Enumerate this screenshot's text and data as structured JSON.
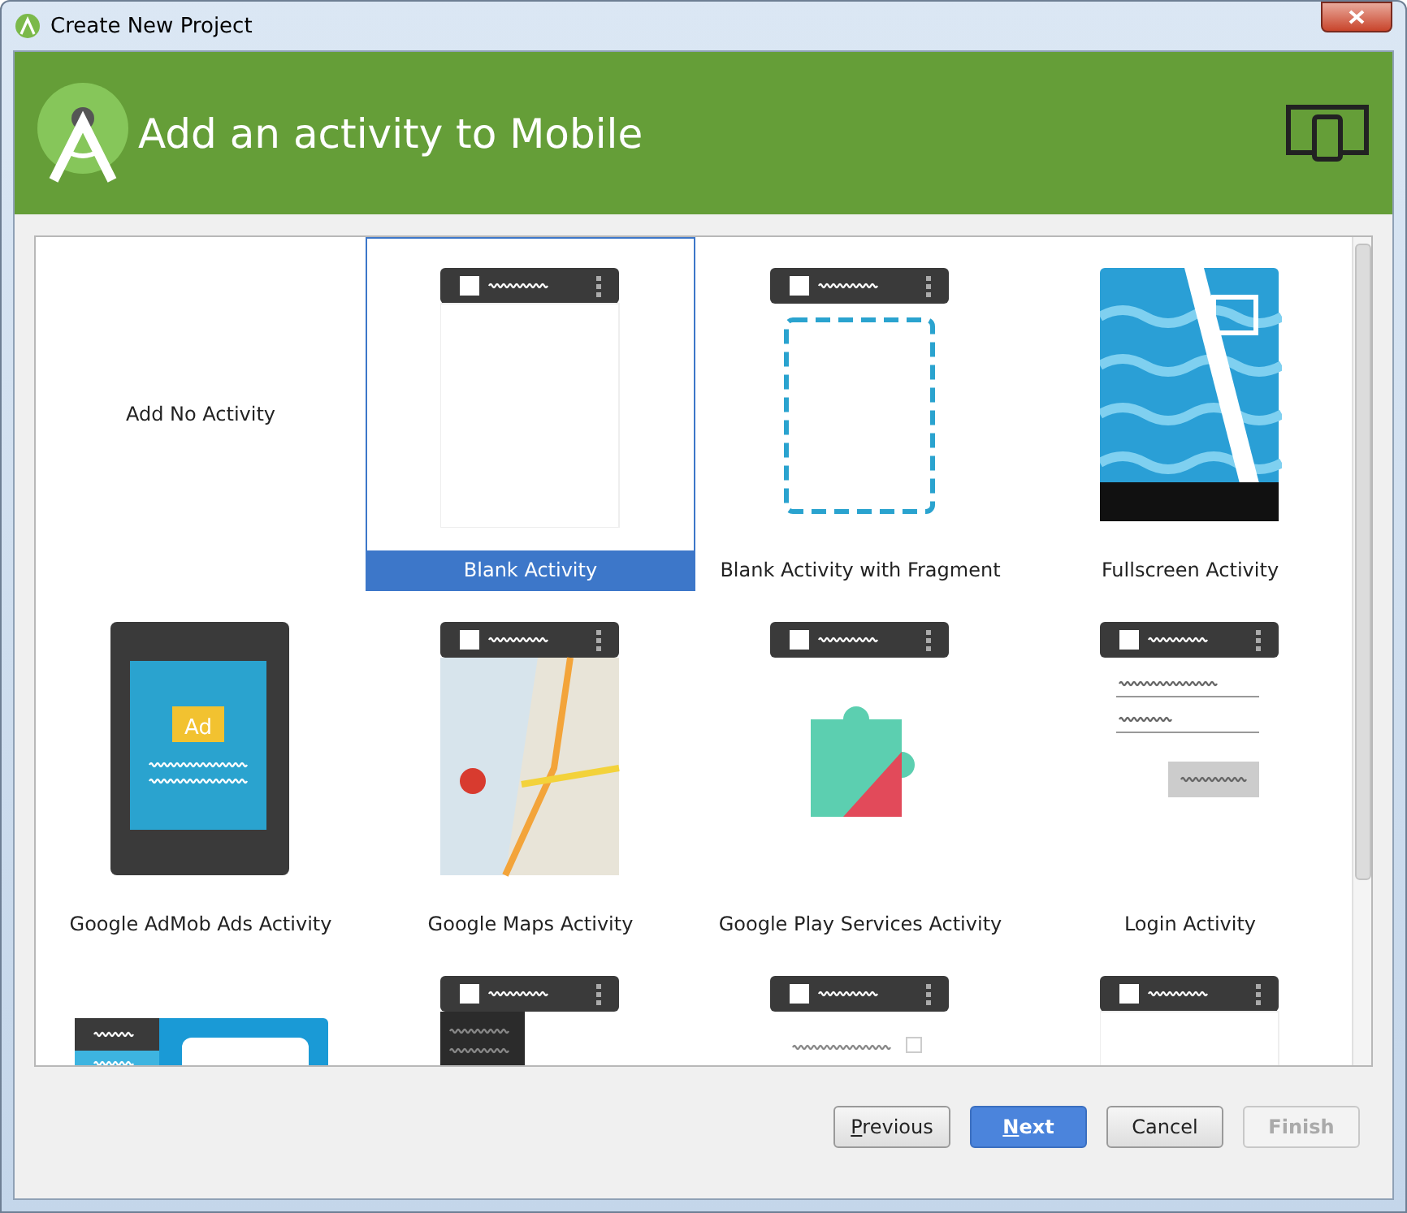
{
  "window": {
    "title": "Create New Project"
  },
  "header": {
    "title": "Add an activity to Mobile"
  },
  "templates": [
    {
      "kind": "none",
      "label": "Add No Activity",
      "selected": false
    },
    {
      "kind": "blank",
      "label": "Blank Activity",
      "selected": true
    },
    {
      "kind": "fragment",
      "label": "Blank Activity with Fragment",
      "selected": false
    },
    {
      "kind": "fullscreen",
      "label": "Fullscreen Activity",
      "selected": false
    },
    {
      "kind": "admob",
      "label": "Google AdMob Ads Activity",
      "badge": "Ad",
      "selected": false
    },
    {
      "kind": "maps",
      "label": "Google Maps Activity",
      "selected": false
    },
    {
      "kind": "play",
      "label": "Google Play Services Activity",
      "selected": false
    },
    {
      "kind": "login",
      "label": "Login Activity",
      "selected": false
    },
    {
      "kind": "masterdetail",
      "selected": false
    },
    {
      "kind": "drawer",
      "selected": false
    },
    {
      "kind": "settings",
      "selected": false
    },
    {
      "kind": "blank",
      "selected": false
    }
  ],
  "buttons": [
    {
      "label": "Previous",
      "mnemonic": true,
      "primary": false,
      "disabled": false
    },
    {
      "label": "Next",
      "mnemonic": true,
      "primary": true,
      "disabled": false
    },
    {
      "label": "Cancel",
      "mnemonic": false,
      "primary": false,
      "disabled": false
    },
    {
      "label": "Finish",
      "mnemonic": false,
      "primary": false,
      "disabled": true
    }
  ]
}
